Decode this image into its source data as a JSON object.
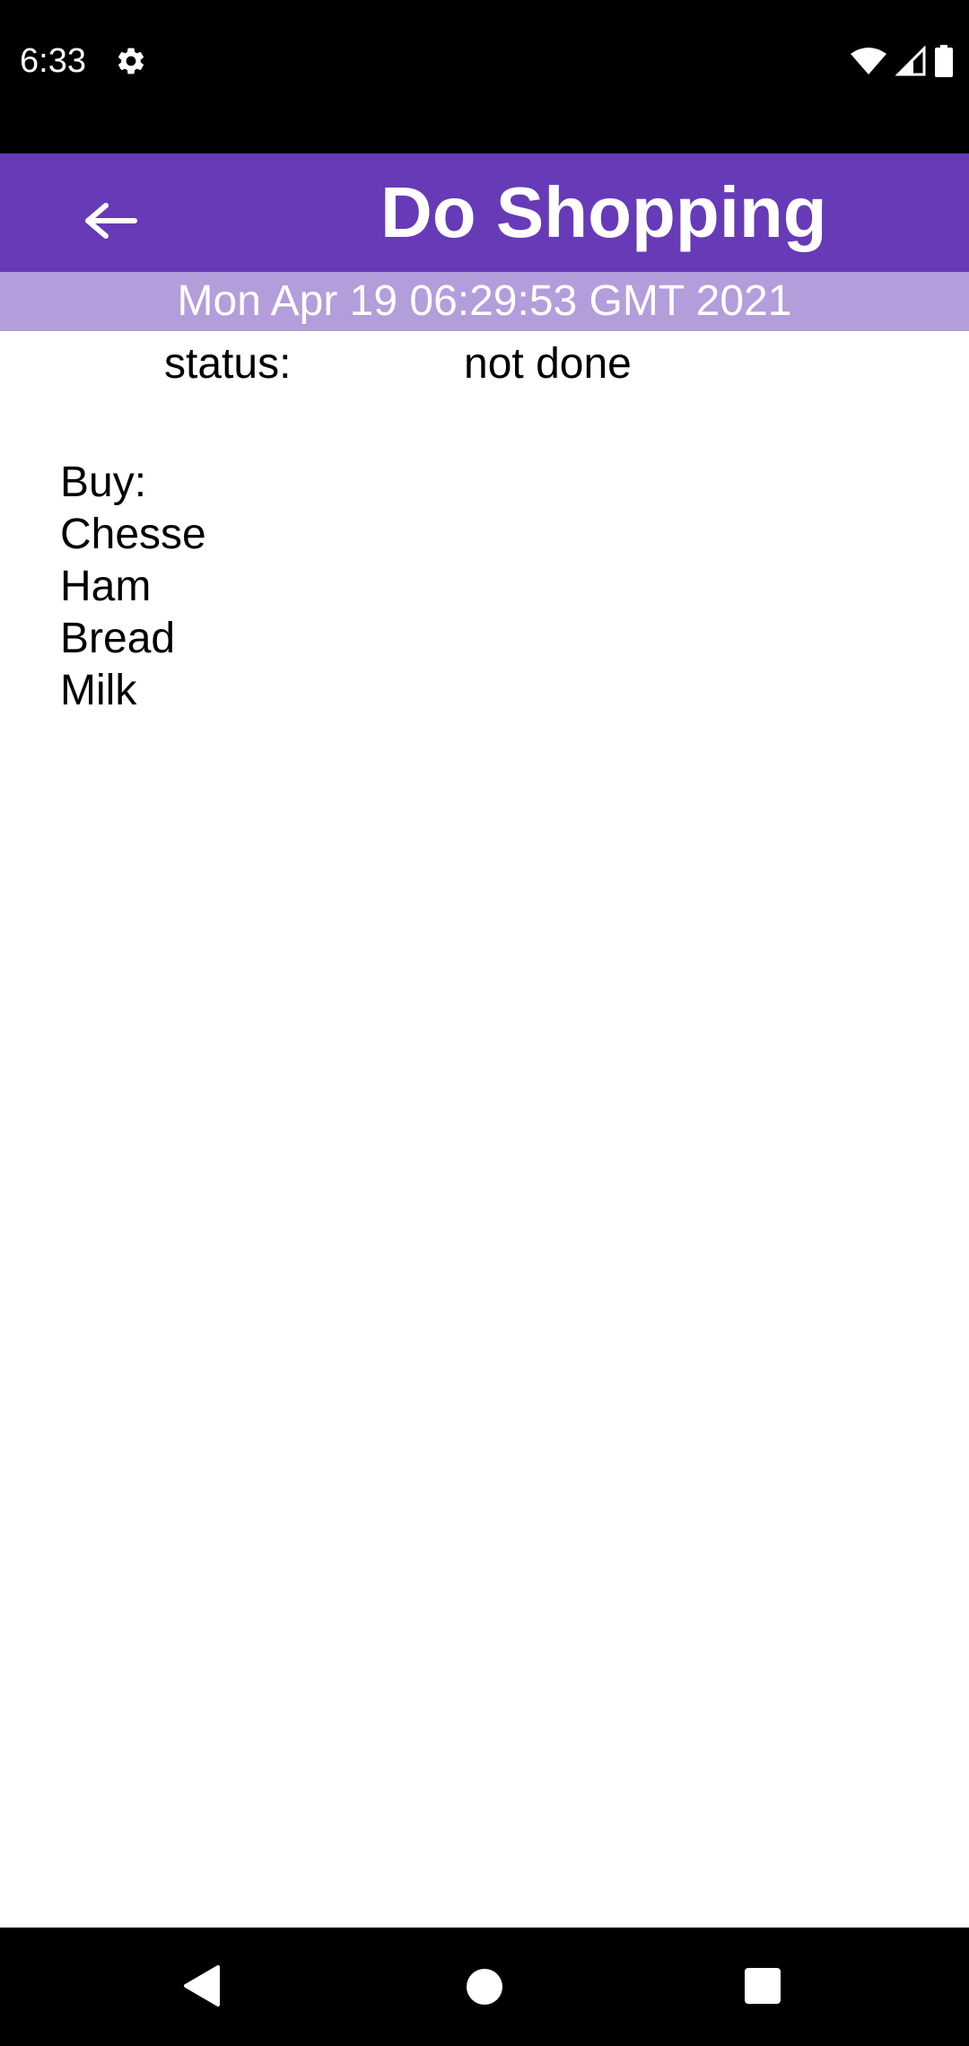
{
  "status_bar": {
    "time": "6:33",
    "icons": [
      "gear-icon",
      "wifi-icon",
      "signal-icon",
      "battery-icon"
    ]
  },
  "app_bar": {
    "title": "Do Shopping",
    "back_icon": "back-arrow-icon",
    "color": "#673ab7"
  },
  "date_strip": {
    "text": "Mon Apr 19 06:29:53 GMT 2021",
    "color": "#b39ddb"
  },
  "task_status": {
    "label": "status:",
    "value": "not done"
  },
  "note": {
    "lines": [
      "Buy:",
      "Chesse",
      "Ham",
      "Bread",
      "Milk"
    ]
  },
  "nav_bar": {
    "icons": [
      "nav-back-icon",
      "nav-home-icon",
      "nav-recents-icon"
    ]
  }
}
